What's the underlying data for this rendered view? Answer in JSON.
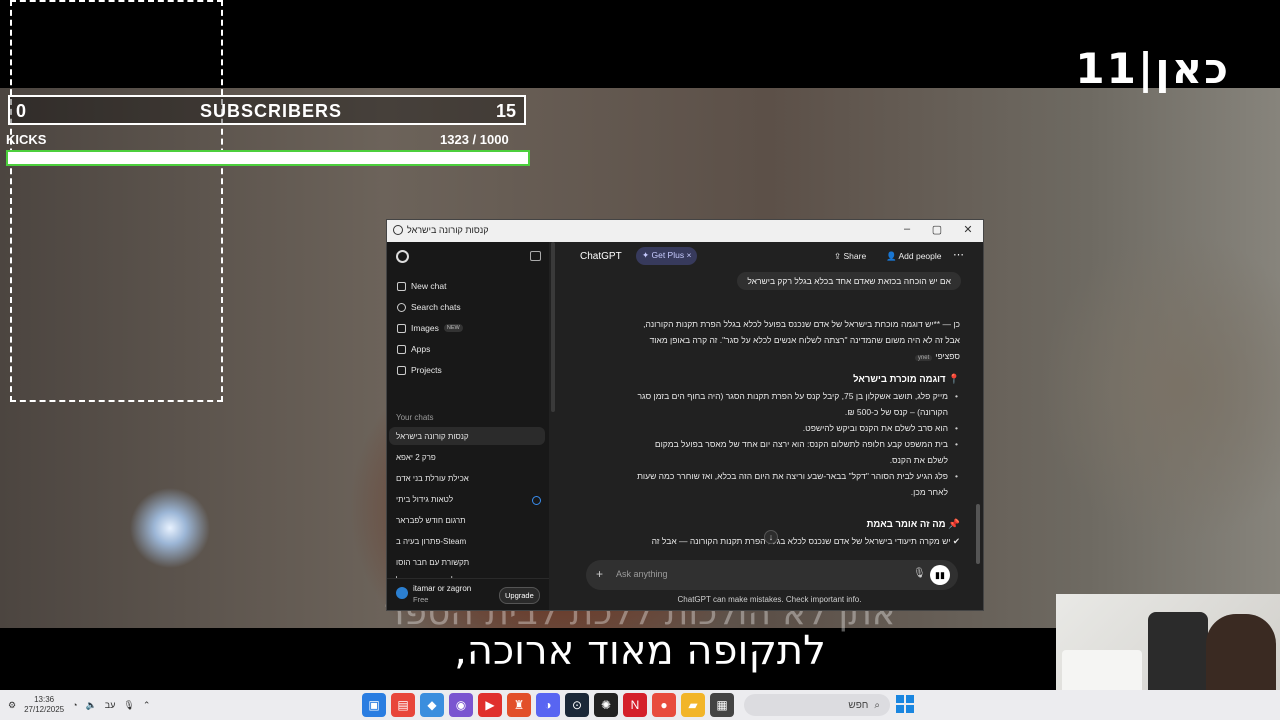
{
  "video": {
    "channel_logo": "כאן|11",
    "subtitle": "לתקופה מאוד ארוכה,",
    "subtitle_ghost": "אתן לא הולכות ללכת לבית הספר"
  },
  "stream_overlay": {
    "subs_left": "0",
    "subs_label": "SUBSCRIBERS",
    "subs_right": "15",
    "kicks_label": "KICKS",
    "kicks_count": "1323  /  1000",
    "kicks_progress": 1.0
  },
  "window": {
    "title": "קנסות קורונה בישראל",
    "sidebar": {
      "items": [
        {
          "label": "New chat",
          "icon": "pencil-icon"
        },
        {
          "label": "Search chats",
          "icon": "search-icon"
        },
        {
          "label": "Images",
          "icon": "image-icon",
          "badge": "NEW"
        },
        {
          "label": "Apps",
          "icon": "apps-icon"
        },
        {
          "label": "Projects",
          "icon": "folder-icon"
        }
      ],
      "section_label": "Your chats",
      "chats": [
        "קנסות קורונה בישראל",
        "פרק 2 יאפא",
        "אכילת עורלת בני אדם",
        "לטאות גידול ביתי",
        "תרגום חודש לפבראר",
        "Steam-פתרון בעיה ב",
        "תקשורת עם חבר הוסו",
        "לטאה בבית טיפול"
      ],
      "user_name": "itamar or zagron",
      "user_plan": "Free",
      "upgrade_label": "Upgrade"
    },
    "header": {
      "title": "ChatGPT",
      "get_plus": "Get Plus",
      "share": "Share",
      "add_people": "Add people"
    },
    "user_message": "אם יש הוכחה בכזאת  שאדם אחד בכלא בגלל רקק בישראל",
    "answer": {
      "intro_line1": "כן — **יש דוגמה מוכחת בישראל של אדם שנכנס בפועל לכלא בגלל הפרת תקנות הקורונה,",
      "intro_line2": "אבל זה לא היה משום שהמדינה \"רצתה לשלוח אנשים לכלא על סגר\". זה קרה באופן מאוד",
      "intro_line3": "ספציפי",
      "heading1": "📍 דוגמה מוכרת בישראל",
      "b1_line1": "מייק פלג, תושב אשקלון בן 75, קיבל קנס על הפרת תקנות הסגר (היה בחוף הים בזמן סגר",
      "b1_line2": "הקורונה) – קנס של כ-500 ₪.",
      "b2": "הוא סרב לשלם את הקנס וביקש להישפט.",
      "b3_line1": "בית המשפט קבע חלופה לתשלום הקנס: הוא ירצה יום אחד של מאסר בפועל במקום",
      "b3_line2": "לשלם את הקנס.",
      "b4_line1": "פלג הגיע לבית הסוהר \"דקל\" בבאר-שבע וריצה את היום הזה בכלא, ואז שוחרר כמה שעות",
      "b4_line2": "לאחר מכן.",
      "heading2": "📌 מה זה אומר באמת",
      "last_line": "✔ יש מקרה תיעודי בישראל של אדם שנכנס לכלא בגלל הפרת תקנות הקורונה — אבל זה"
    },
    "composer_placeholder": "Ask anything",
    "disclaimer": "ChatGPT can make mistakes. Check important info."
  },
  "taskbar": {
    "time": "13:36",
    "date": "27/12/2025",
    "lang": "עב",
    "search_placeholder": "חפש"
  }
}
